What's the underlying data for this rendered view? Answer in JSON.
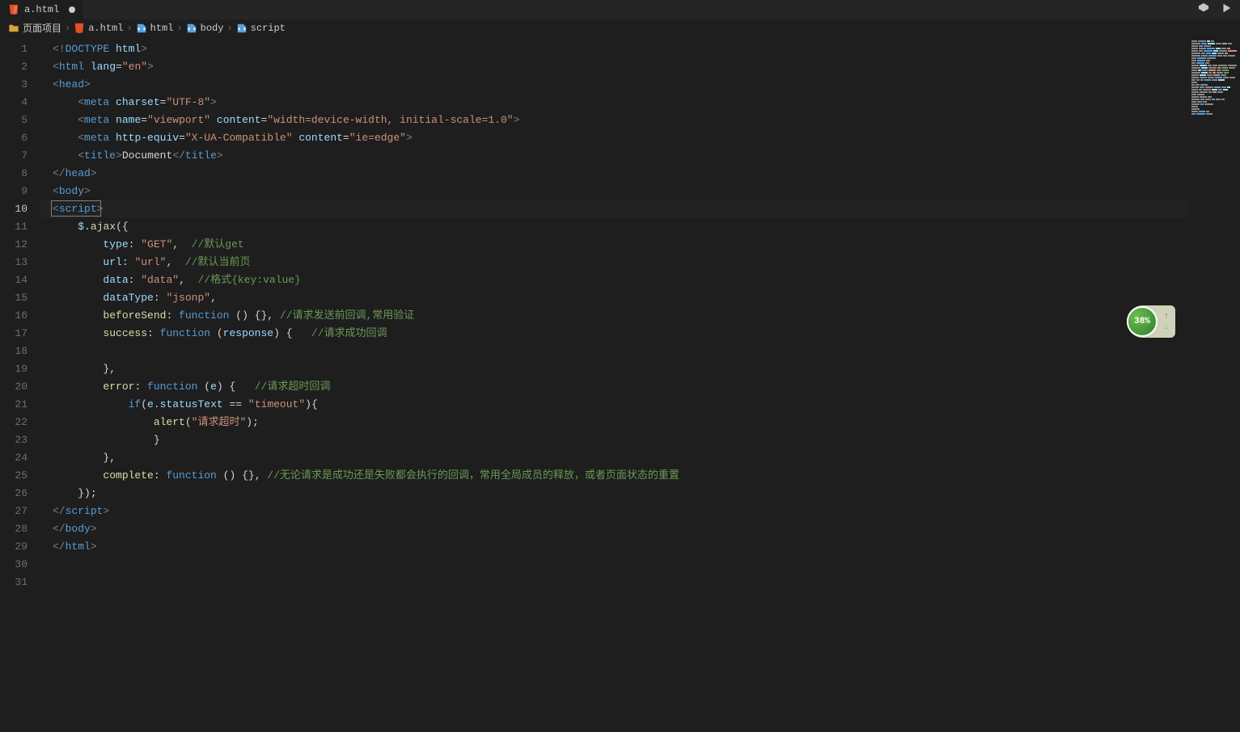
{
  "tab": {
    "filename": "a.html",
    "dirty": true
  },
  "breadcrumb": [
    {
      "icon": "folder",
      "label": "页面项目"
    },
    {
      "icon": "html5",
      "label": "a.html"
    },
    {
      "icon": "tag",
      "label": "html"
    },
    {
      "icon": "tag",
      "label": "body"
    },
    {
      "icon": "tag",
      "label": "script"
    }
  ],
  "widget": {
    "percent": "38%"
  },
  "active_line": 10,
  "total_lines": 31,
  "code_lines": [
    {
      "n": 1,
      "tokens": [
        [
          "c-tag",
          "<!"
        ],
        [
          "c-doctype",
          "DOCTYPE "
        ],
        [
          "c-attr",
          "html"
        ],
        [
          "c-tag",
          ">"
        ]
      ]
    },
    {
      "n": 2,
      "tokens": [
        [
          "c-tag",
          "<"
        ],
        [
          "c-elem",
          "html "
        ],
        [
          "c-attr",
          "lang"
        ],
        [
          "c-punc",
          "="
        ],
        [
          "c-str",
          "\"en\""
        ],
        [
          "c-tag",
          ">"
        ]
      ]
    },
    {
      "n": 3,
      "tokens": [
        [
          "c-tag",
          "<"
        ],
        [
          "c-elem",
          "head"
        ],
        [
          "c-tag",
          ">"
        ]
      ]
    },
    {
      "n": 4,
      "tokens": [
        [
          "c-text",
          "    "
        ],
        [
          "c-tag",
          "<"
        ],
        [
          "c-elem",
          "meta "
        ],
        [
          "c-attr",
          "charset"
        ],
        [
          "c-punc",
          "="
        ],
        [
          "c-str",
          "\"UTF-8\""
        ],
        [
          "c-tag",
          ">"
        ]
      ]
    },
    {
      "n": 5,
      "tokens": [
        [
          "c-text",
          "    "
        ],
        [
          "c-tag",
          "<"
        ],
        [
          "c-elem",
          "meta "
        ],
        [
          "c-attr",
          "name"
        ],
        [
          "c-punc",
          "="
        ],
        [
          "c-str",
          "\"viewport\""
        ],
        [
          "c-text",
          " "
        ],
        [
          "c-attr",
          "content"
        ],
        [
          "c-punc",
          "="
        ],
        [
          "c-str",
          "\"width=device-width, initial-scale=1.0\""
        ],
        [
          "c-tag",
          ">"
        ]
      ]
    },
    {
      "n": 6,
      "tokens": [
        [
          "c-text",
          "    "
        ],
        [
          "c-tag",
          "<"
        ],
        [
          "c-elem",
          "meta "
        ],
        [
          "c-attr",
          "http-equiv"
        ],
        [
          "c-punc",
          "="
        ],
        [
          "c-str",
          "\"X-UA-Compatible\""
        ],
        [
          "c-text",
          " "
        ],
        [
          "c-attr",
          "content"
        ],
        [
          "c-punc",
          "="
        ],
        [
          "c-str",
          "\"ie=edge\""
        ],
        [
          "c-tag",
          ">"
        ]
      ]
    },
    {
      "n": 7,
      "tokens": [
        [
          "c-text",
          "    "
        ],
        [
          "c-tag",
          "<"
        ],
        [
          "c-elem",
          "title"
        ],
        [
          "c-tag",
          ">"
        ],
        [
          "c-text",
          "Document"
        ],
        [
          "c-tag",
          "</"
        ],
        [
          "c-elem",
          "title"
        ],
        [
          "c-tag",
          ">"
        ]
      ]
    },
    {
      "n": 8,
      "tokens": [
        [
          "c-tag",
          "</"
        ],
        [
          "c-elem",
          "head"
        ],
        [
          "c-tag",
          ">"
        ]
      ]
    },
    {
      "n": 9,
      "tokens": [
        [
          "c-tag",
          "<"
        ],
        [
          "c-elem",
          "body"
        ],
        [
          "c-tag",
          ">"
        ]
      ]
    },
    {
      "n": 10,
      "cursor": true,
      "tokens": [
        [
          "c-tag",
          "<"
        ],
        [
          "c-elem",
          "script"
        ],
        [
          "c-tag",
          ">"
        ]
      ]
    },
    {
      "n": 11,
      "tokens": [
        [
          "c-text",
          "    "
        ],
        [
          "c-var",
          "$"
        ],
        [
          "c-punc",
          "."
        ],
        [
          "c-func",
          "ajax"
        ],
        [
          "c-punc",
          "("
        ],
        [
          "c-brace",
          "{"
        ]
      ]
    },
    {
      "n": 12,
      "tokens": [
        [
          "c-text",
          "        "
        ],
        [
          "c-prop",
          "type"
        ],
        [
          "c-punc",
          ": "
        ],
        [
          "c-str",
          "\"GET\""
        ],
        [
          "c-punc",
          ",  "
        ],
        [
          "c-comment",
          "//默认get"
        ]
      ]
    },
    {
      "n": 13,
      "tokens": [
        [
          "c-text",
          "        "
        ],
        [
          "c-prop",
          "url"
        ],
        [
          "c-punc",
          ": "
        ],
        [
          "c-str",
          "\"url\""
        ],
        [
          "c-punc",
          ",  "
        ],
        [
          "c-comment",
          "//默认当前页"
        ]
      ]
    },
    {
      "n": 14,
      "tokens": [
        [
          "c-text",
          "        "
        ],
        [
          "c-prop",
          "data"
        ],
        [
          "c-punc",
          ": "
        ],
        [
          "c-str",
          "\"data\""
        ],
        [
          "c-punc",
          ",  "
        ],
        [
          "c-comment",
          "//格式{key:value}"
        ]
      ]
    },
    {
      "n": 15,
      "tokens": [
        [
          "c-text",
          "        "
        ],
        [
          "c-prop",
          "dataType"
        ],
        [
          "c-punc",
          ": "
        ],
        [
          "c-str",
          "\"jsonp\""
        ],
        [
          "c-punc",
          ","
        ]
      ]
    },
    {
      "n": 16,
      "tokens": [
        [
          "c-text",
          "        "
        ],
        [
          "c-func",
          "beforeSend"
        ],
        [
          "c-punc",
          ": "
        ],
        [
          "c-keyword",
          "function "
        ],
        [
          "c-punc",
          "() "
        ],
        [
          "c-brace",
          "{}"
        ],
        [
          "c-punc",
          ", "
        ],
        [
          "c-comment",
          "//请求发送前回调,常用验证"
        ]
      ]
    },
    {
      "n": 17,
      "tokens": [
        [
          "c-text",
          "        "
        ],
        [
          "c-func",
          "success"
        ],
        [
          "c-punc",
          ": "
        ],
        [
          "c-keyword",
          "function "
        ],
        [
          "c-punc",
          "("
        ],
        [
          "c-var",
          "response"
        ],
        [
          "c-punc",
          ") "
        ],
        [
          "c-brace",
          "{"
        ],
        [
          "c-text",
          "   "
        ],
        [
          "c-comment",
          "//请求成功回调"
        ]
      ]
    },
    {
      "n": 18,
      "tokens": [
        [
          "c-text",
          "        "
        ]
      ]
    },
    {
      "n": 19,
      "tokens": [
        [
          "c-text",
          "        "
        ],
        [
          "c-brace",
          "}"
        ],
        [
          "c-punc",
          ","
        ]
      ]
    },
    {
      "n": 20,
      "tokens": [
        [
          "c-text",
          "        "
        ],
        [
          "c-func",
          "error"
        ],
        [
          "c-punc",
          ": "
        ],
        [
          "c-keyword",
          "function "
        ],
        [
          "c-punc",
          "("
        ],
        [
          "c-var",
          "e"
        ],
        [
          "c-punc",
          ") "
        ],
        [
          "c-brace",
          "{"
        ],
        [
          "c-text",
          "   "
        ],
        [
          "c-comment",
          "//请求超时回调"
        ]
      ]
    },
    {
      "n": 21,
      "tokens": [
        [
          "c-text",
          "            "
        ],
        [
          "c-keyword",
          "if"
        ],
        [
          "c-punc",
          "("
        ],
        [
          "c-var",
          "e"
        ],
        [
          "c-punc",
          "."
        ],
        [
          "c-var",
          "statusText"
        ],
        [
          "c-text",
          " "
        ],
        [
          "c-op",
          "=="
        ],
        [
          "c-text",
          " "
        ],
        [
          "c-str",
          "\"timeout\""
        ],
        [
          "c-punc",
          ")"
        ],
        [
          "c-brace",
          "{"
        ]
      ]
    },
    {
      "n": 22,
      "tokens": [
        [
          "c-text",
          "                "
        ],
        [
          "c-func",
          "alert"
        ],
        [
          "c-punc",
          "("
        ],
        [
          "c-str",
          "\"请求超时\""
        ],
        [
          "c-punc",
          ");"
        ]
      ]
    },
    {
      "n": 23,
      "tokens": [
        [
          "c-text",
          "                "
        ],
        [
          "c-brace",
          "}"
        ]
      ]
    },
    {
      "n": 24,
      "tokens": [
        [
          "c-text",
          "        "
        ],
        [
          "c-brace",
          "}"
        ],
        [
          "c-punc",
          ","
        ]
      ]
    },
    {
      "n": 25,
      "tokens": [
        [
          "c-text",
          "        "
        ],
        [
          "c-func",
          "complete"
        ],
        [
          "c-punc",
          ": "
        ],
        [
          "c-keyword",
          "function "
        ],
        [
          "c-punc",
          "() "
        ],
        [
          "c-brace",
          "{}"
        ],
        [
          "c-punc",
          ", "
        ],
        [
          "c-comment",
          "//无论请求是成功还是失败都会执行的回调，常用全局成员的释放，或者页面状态的重置"
        ]
      ]
    },
    {
      "n": 26,
      "tokens": [
        [
          "c-text",
          "    "
        ],
        [
          "c-brace",
          "}"
        ],
        [
          "c-punc",
          ");"
        ]
      ]
    },
    {
      "n": 27,
      "tokens": [
        [
          "c-tag",
          "</"
        ],
        [
          "c-elem",
          "script"
        ],
        [
          "c-tag",
          ">"
        ]
      ]
    },
    {
      "n": 28,
      "tokens": []
    },
    {
      "n": 29,
      "tokens": []
    },
    {
      "n": 30,
      "tokens": [
        [
          "c-tag",
          "</"
        ],
        [
          "c-elem",
          "body"
        ],
        [
          "c-tag",
          ">"
        ]
      ]
    },
    {
      "n": 31,
      "tokens": [
        [
          "c-tag",
          "</"
        ],
        [
          "c-elem",
          "html"
        ],
        [
          "c-tag",
          ">"
        ]
      ]
    }
  ]
}
